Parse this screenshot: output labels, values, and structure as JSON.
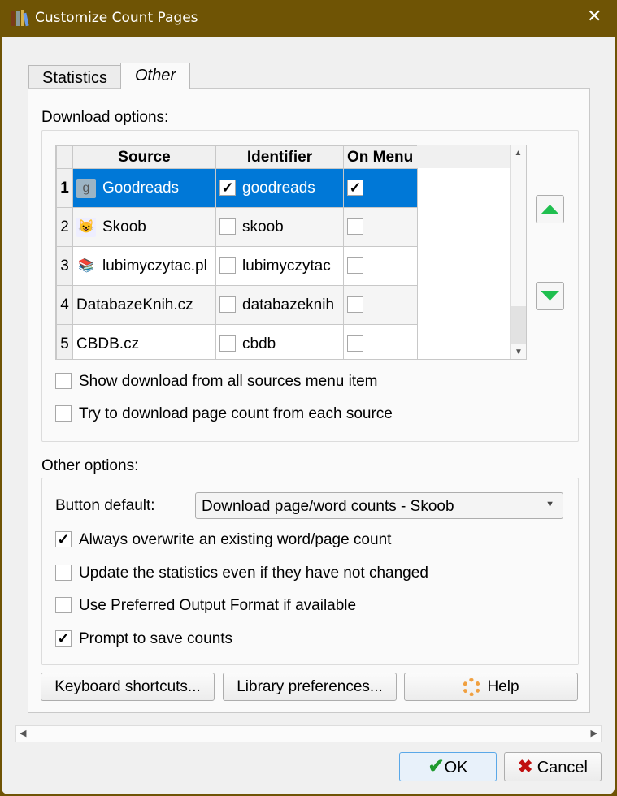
{
  "window": {
    "title": "Customize Count Pages",
    "close_icon": "close-icon"
  },
  "tabs": [
    {
      "label": "Statistics"
    },
    {
      "label": "Other",
      "active": true
    }
  ],
  "download": {
    "label": "Download options:",
    "columns": [
      "Source",
      "Identifier",
      "On Menu"
    ],
    "rows": [
      {
        "num": "1",
        "source": "Goodreads",
        "icon": "goodreads-icon",
        "identifier": "goodreads",
        "id_checked": true,
        "on_menu": true,
        "selected": true
      },
      {
        "num": "2",
        "source": "Skoob",
        "icon": "skoob-icon",
        "identifier": "skoob",
        "id_checked": false,
        "on_menu": false
      },
      {
        "num": "3",
        "source": "lubimyczytac.pl",
        "icon": "lubimyczytac-icon",
        "identifier": "lubimyczytac",
        "id_checked": false,
        "on_menu": false
      },
      {
        "num": "4",
        "source": "DatabazeKnih.cz",
        "icon": "",
        "identifier": "databazeknih",
        "id_checked": false,
        "on_menu": false
      },
      {
        "num": "5",
        "source": "CBDB.cz",
        "icon": "",
        "identifier": "cbdb",
        "id_checked": false,
        "on_menu": false
      }
    ],
    "show_all_label": "Show download from all sources menu item",
    "show_all_checked": false,
    "try_each_label": "Try to download page count from each source",
    "try_each_checked": false
  },
  "other": {
    "label": "Other options:",
    "button_default_label": "Button default:",
    "button_default_value": "Download page/word counts - Skoob",
    "options": [
      {
        "label": "Always overwrite an existing word/page count",
        "checked": true
      },
      {
        "label": "Update the statistics even if they have not changed",
        "checked": false
      },
      {
        "label": "Use Preferred Output Format if available",
        "checked": false
      },
      {
        "label": "Prompt to save counts",
        "checked": true
      }
    ]
  },
  "buttons": {
    "keyboard": "Keyboard shortcuts...",
    "library": "Library preferences...",
    "help": "Help",
    "ok": "OK",
    "cancel": "Cancel"
  },
  "colors": {
    "titlebar": "#6f5405",
    "selection": "#0078d7",
    "arrow": "#1fbf4f"
  }
}
